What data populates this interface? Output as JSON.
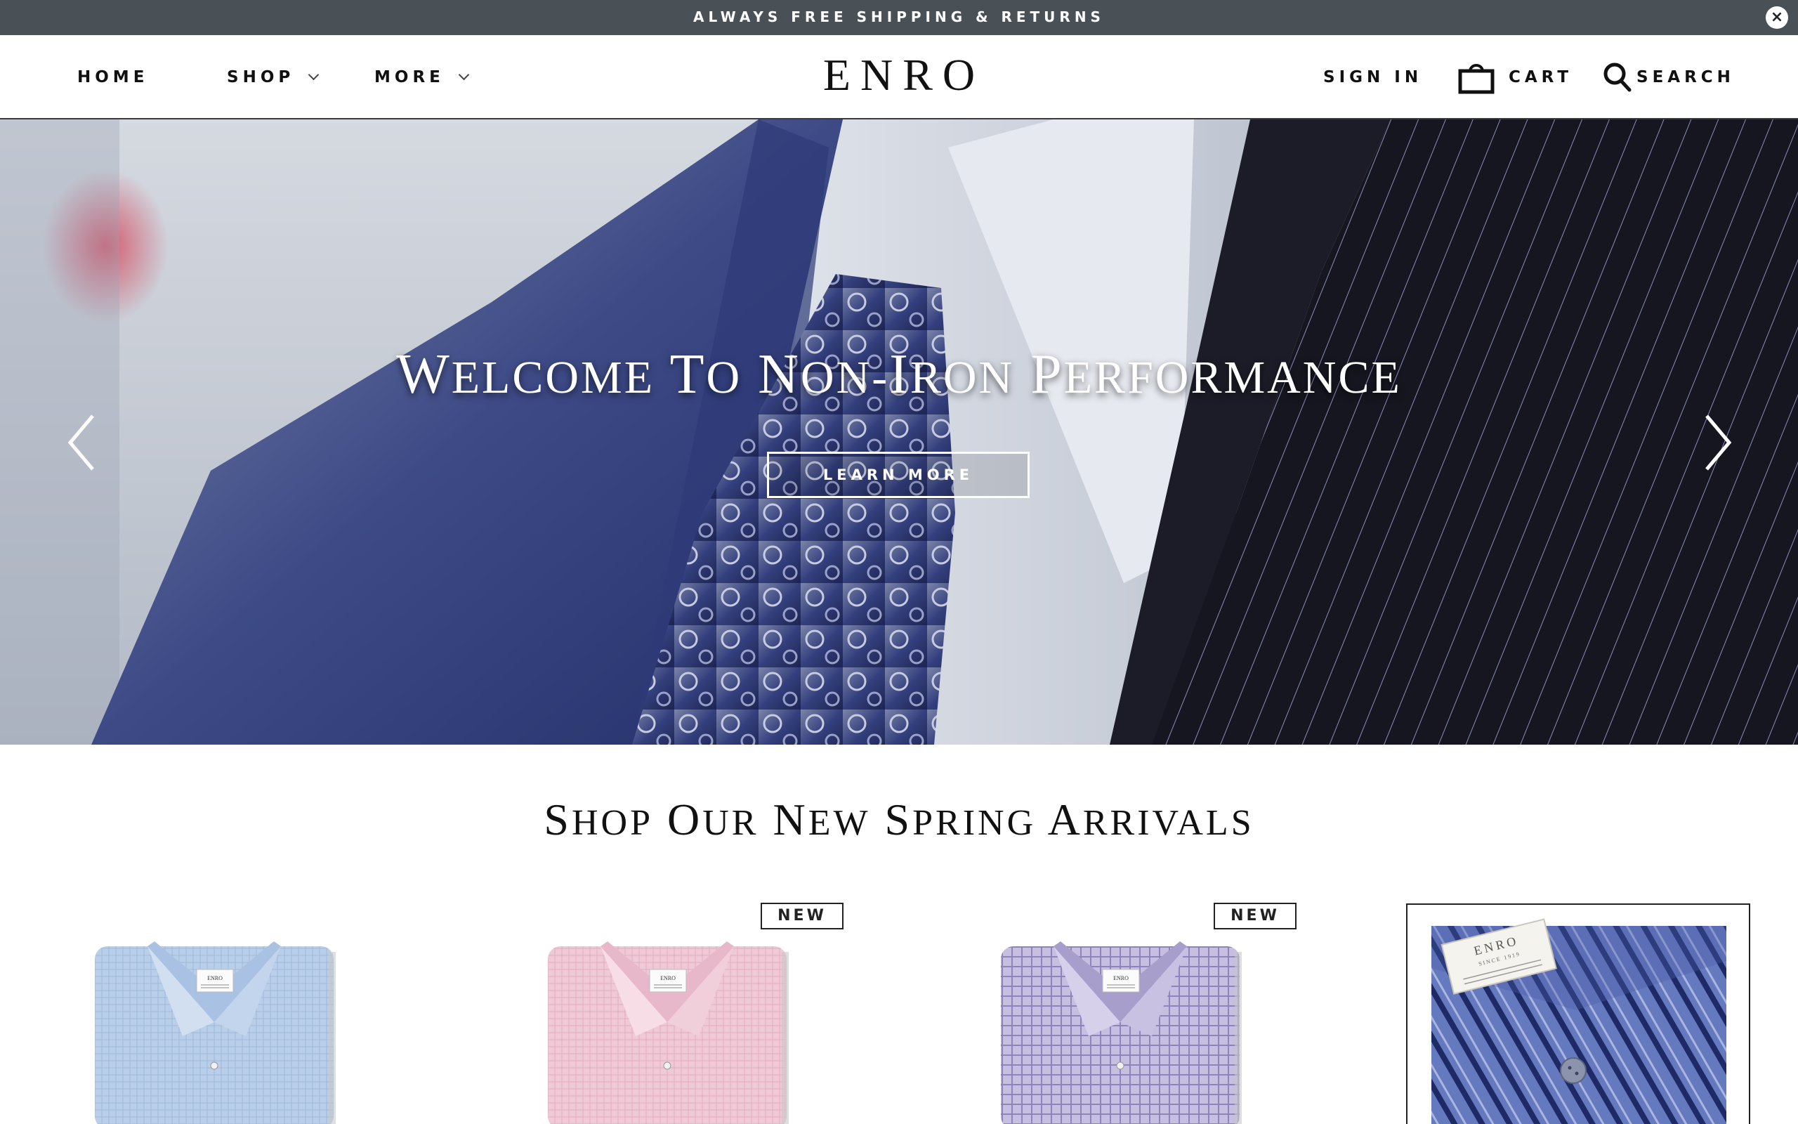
{
  "announcement": {
    "text": "ALWAYS FREE SHIPPING & RETURNS",
    "close_label": "×"
  },
  "header": {
    "nav": [
      {
        "label": "HOME"
      },
      {
        "label": "SHOP"
      },
      {
        "label": "MORE"
      }
    ],
    "logo": "ENRO",
    "sign_in": "SIGN IN",
    "cart": "CART",
    "search": "SEARCH"
  },
  "hero": {
    "title_parts": [
      {
        "cap": "W",
        "rest": "ELCOME"
      },
      {
        "cap": "T",
        "rest": "O"
      },
      {
        "cap": "N",
        "rest": "ON-"
      },
      {
        "cap": "I",
        "rest": "RON"
      },
      {
        "cap": "P",
        "rest": "ERFORMANCE"
      }
    ],
    "button": "LEARN MORE",
    "prev_icon": "chevron-left-icon",
    "next_icon": "chevron-right-icon"
  },
  "section": {
    "title_parts": [
      {
        "cap": "S",
        "rest": "HOP"
      },
      {
        "cap": "O",
        "rest": "UR"
      },
      {
        "cap": "N",
        "rest": "EW"
      },
      {
        "cap": "S",
        "rest": "PRING"
      },
      {
        "cap": "A",
        "rest": "RRIVALS"
      }
    ]
  },
  "products": [
    {
      "badge": "",
      "shirt_color": "#b9cfe9",
      "pattern_color": "#9fb8da"
    },
    {
      "badge": "NEW",
      "shirt_color": "#efc9d6",
      "pattern_color": "#e2adc0"
    },
    {
      "badge": "NEW",
      "shirt_color": "#b7aed6",
      "pattern_color": "#8f83bd"
    },
    {
      "badge": "",
      "shirt_color": "#5b70b8",
      "pattern_color": "#1d2a66"
    }
  ],
  "label_text": {
    "brand": "ENRO",
    "since": "SINCE 1919"
  },
  "colors": {
    "announce_bg": "#4a5156",
    "text": "#111111"
  }
}
